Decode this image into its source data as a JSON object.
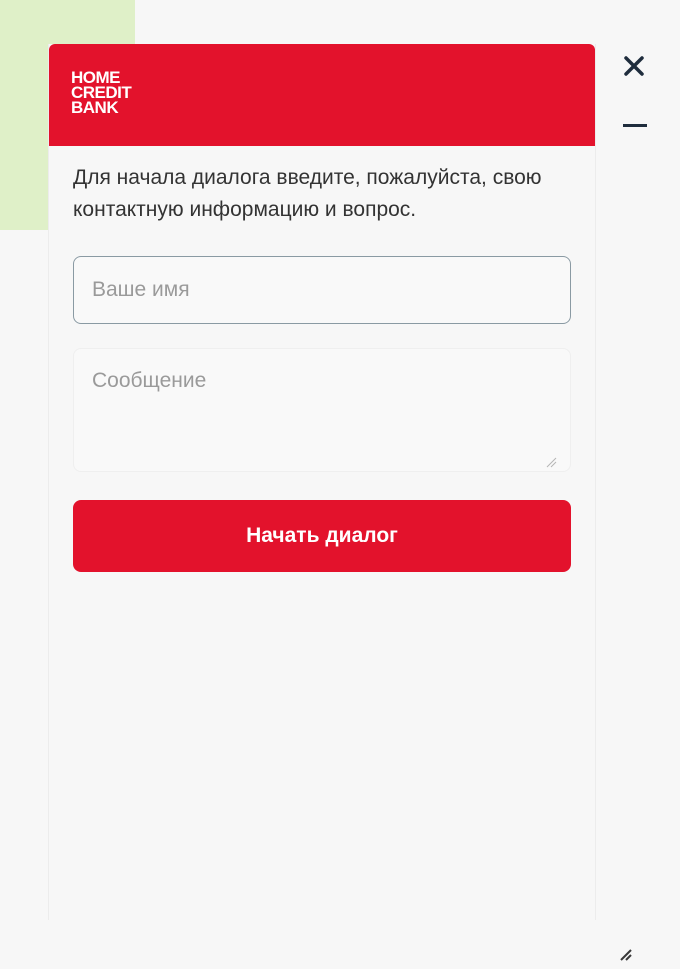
{
  "header": {
    "logo_line1": "HOME",
    "logo_line2": "CREDIT",
    "logo_line3": "BANK"
  },
  "form": {
    "intro_text": "Для начала диалога введите, пожалуйста, свою контактную информацию и вопрос.",
    "name_placeholder": "Ваше имя",
    "name_value": "",
    "message_placeholder": "Сообщение",
    "message_value": "",
    "submit_label": "Начать диалог"
  },
  "icons": {
    "close": "close-icon",
    "minimize": "minimize-icon",
    "textarea_resize": "resize-grip-icon",
    "window_resize": "resize-handle-icon"
  },
  "colors": {
    "brand_red": "#e3122c",
    "intro_text": "#333333",
    "placeholder": "#9a9a9a",
    "close_icon": "#1f2d3d"
  }
}
